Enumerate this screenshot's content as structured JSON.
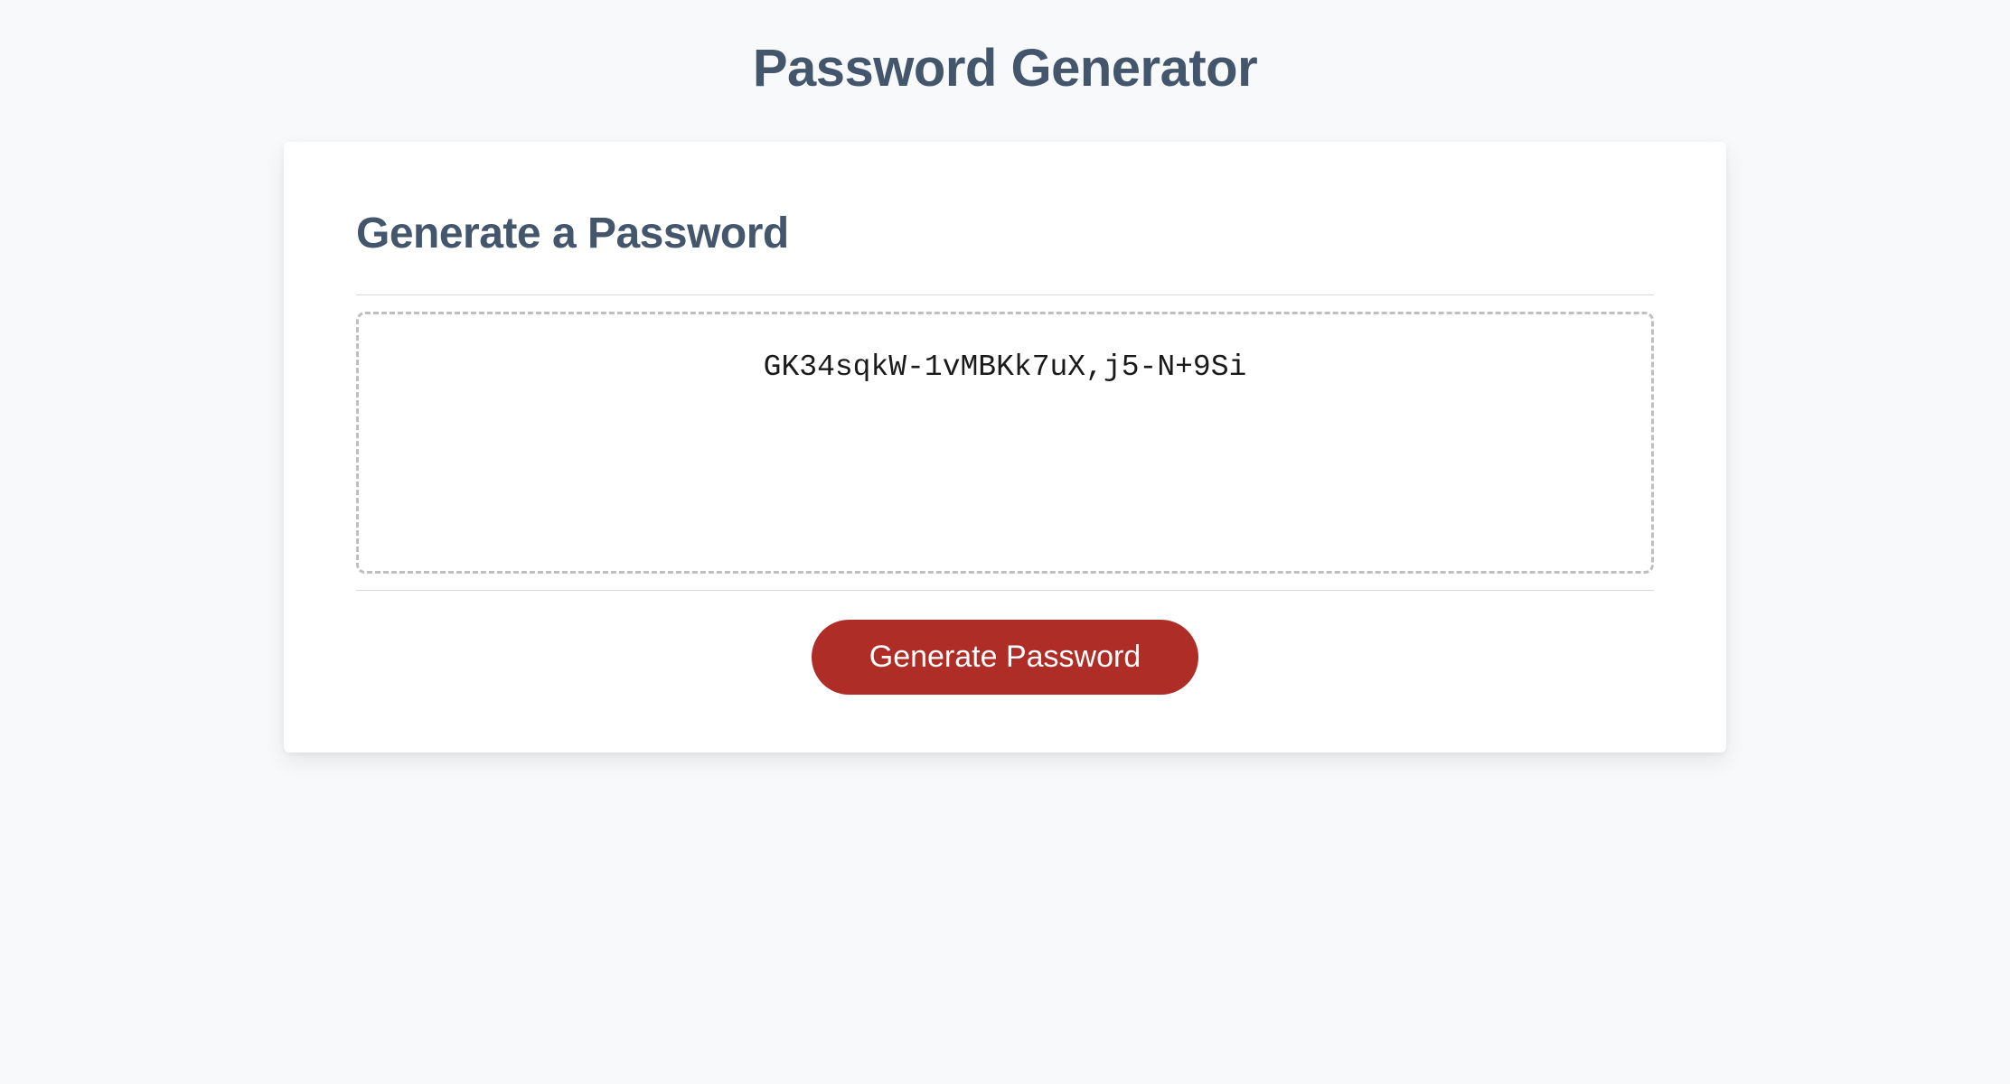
{
  "header": {
    "title": "Password Generator"
  },
  "card": {
    "heading": "Generate a Password",
    "password_value": "GK34sqkW-1vMBKk7uX,j5-N+9Si",
    "generate_button_label": "Generate Password"
  },
  "colors": {
    "background": "#f7f9fb",
    "card_bg": "#ffffff",
    "heading_text": "#44566c",
    "button_bg": "#af2d27",
    "button_text": "#ffffff",
    "dashed_border": "#bfbfbf"
  }
}
